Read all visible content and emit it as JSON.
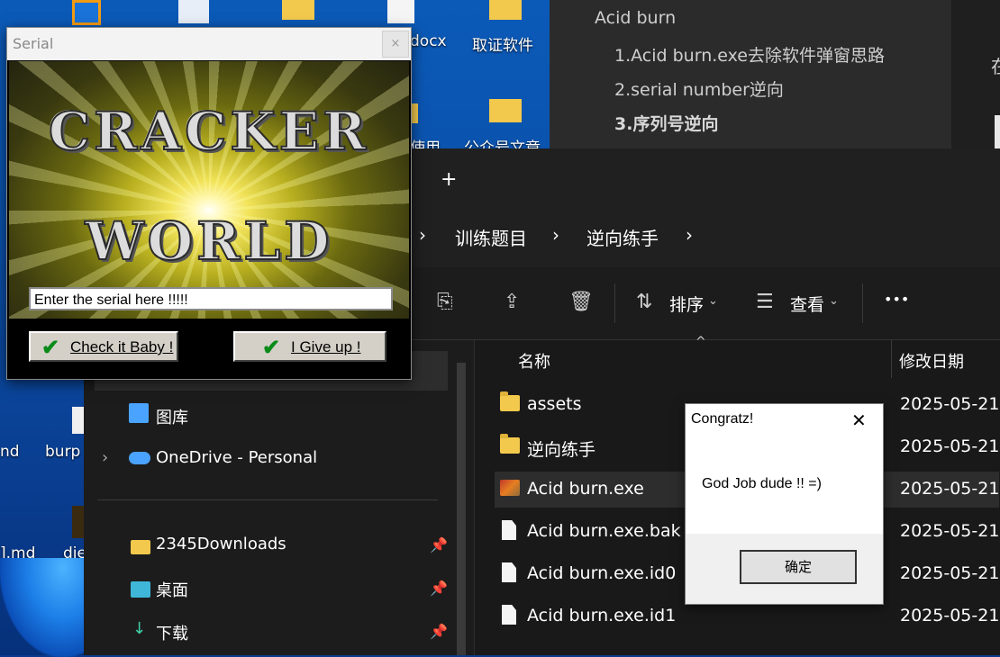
{
  "desktop": {
    "labels": [
      "docx",
      "取证软件",
      "使用",
      "公众号文章",
      "nd",
      "burp",
      "].md",
      "die"
    ]
  },
  "notes": {
    "heading": "Acid burn",
    "items": [
      "1.Acid burn.exe去除软件弹窗思路",
      "2.serial number逆向",
      "3.序列号逆向"
    ],
    "side_glyph": "在"
  },
  "explorer": {
    "new_tab": "+",
    "breadcrumb": [
      "训练题目",
      "逆向练手"
    ],
    "crumb_sep": "›",
    "toolbar": {
      "sort": "排序",
      "view": "查看",
      "more": "•••"
    },
    "nav": {
      "items": [
        "图库",
        "OneDrive - Personal"
      ],
      "quick": [
        "2345Downloads",
        "桌面",
        "下载"
      ]
    },
    "columns": {
      "name": "名称",
      "modified": "修改日期"
    },
    "files": [
      {
        "name": "assets",
        "date": "2025-05-21",
        "type": "folder"
      },
      {
        "name": "逆向练手",
        "date": "2025-05-21",
        "type": "folder"
      },
      {
        "name": "Acid burn.exe",
        "date": "2025-05-21",
        "type": "exe"
      },
      {
        "name": "Acid burn.exe.bak",
        "date": "2025-05-21",
        "type": "file"
      },
      {
        "name": "Acid burn.exe.id0",
        "date": "2025-05-21",
        "type": "file"
      },
      {
        "name": "Acid burn.exe.id1",
        "date": "2025-05-21",
        "type": "file"
      }
    ]
  },
  "serial_dialog": {
    "title": "Serial",
    "close": "×",
    "banner_top": "CRACKER",
    "banner_bottom": "WORLD",
    "input_value": "Enter the serial here !!!!!",
    "check_button": "Check it Baby !",
    "giveup_button": "I Give up !"
  },
  "congratz_dialog": {
    "title": "Congratz!",
    "close": "✕",
    "message": "God Job dude !! =)",
    "ok_button": "确定"
  }
}
